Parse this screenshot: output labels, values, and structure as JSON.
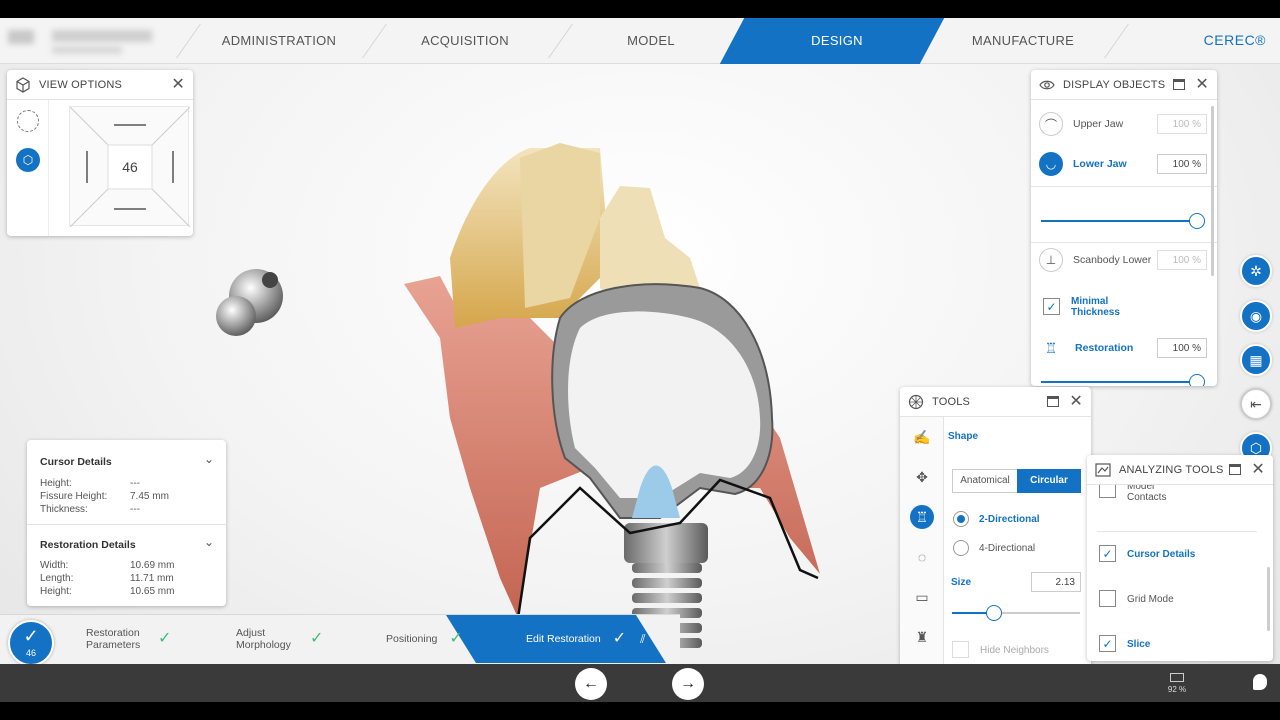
{
  "topnav": {
    "items": [
      "ADMINISTRATION",
      "ACQUISITION",
      "MODEL",
      "DESIGN",
      "MANUFACTURE"
    ],
    "active": "DESIGN",
    "brand": "CEREC®"
  },
  "view_options": {
    "title": "VIEW OPTIONS",
    "tooth_number": "46"
  },
  "display_objects": {
    "title": "DISPLAY OBJECTS",
    "rows": [
      {
        "label": "Upper Jaw",
        "percent": "100 %"
      },
      {
        "label": "Lower Jaw",
        "percent": "100 %"
      },
      {
        "label": "Scanbody Lower",
        "percent": "100 %"
      },
      {
        "label": "Minimal Thickness"
      },
      {
        "label": "Restoration",
        "percent": "100 %"
      }
    ],
    "lower_jaw_opacity": 1.0,
    "restoration_opacity": 1.0
  },
  "tools": {
    "title": "TOOLS",
    "section": "Shape",
    "shape_options": [
      "Anatomical",
      "Circular"
    ],
    "shape_selected": "Circular",
    "direction_options": [
      "2-Directional",
      "4-Directional"
    ],
    "direction_selected": "2-Directional",
    "size_label": "Size",
    "size_value": "2.13",
    "size_fraction": 0.33,
    "hide_neighbors": "Hide Neighbors"
  },
  "analyzing_tools": {
    "title": "ANALYZING TOOLS",
    "items": [
      {
        "label": "Model Contacts",
        "checked": false
      },
      {
        "label": "Cursor Details",
        "checked": true
      },
      {
        "label": "Grid Mode",
        "checked": false
      },
      {
        "label": "Slice",
        "checked": true
      }
    ]
  },
  "cursor_details": {
    "title": "Cursor Details",
    "rows": [
      {
        "label": "Height:",
        "value": "---"
      },
      {
        "label": "Fissure Height:",
        "value": "7.45 mm"
      },
      {
        "label": "Thickness:",
        "value": "---"
      }
    ]
  },
  "restoration_details": {
    "title": "Restoration Details",
    "rows": [
      {
        "label": "Width:",
        "value": "10.69 mm"
      },
      {
        "label": "Length:",
        "value": "11.71 mm"
      },
      {
        "label": "Height:",
        "value": "10.65 mm"
      }
    ]
  },
  "workflow": {
    "badge_number": "46",
    "steps": [
      {
        "label": "Restoration Parameters",
        "done": true
      },
      {
        "label": "Adjust Morphology",
        "done": true
      },
      {
        "label": "Positioning",
        "done": true
      },
      {
        "label": "Edit Restoration",
        "done": true
      }
    ],
    "active": "Edit Restoration"
  },
  "status": {
    "battery": "92 %"
  },
  "colors": {
    "accent": "#1472c4",
    "check_green": "#3fbf6f"
  }
}
